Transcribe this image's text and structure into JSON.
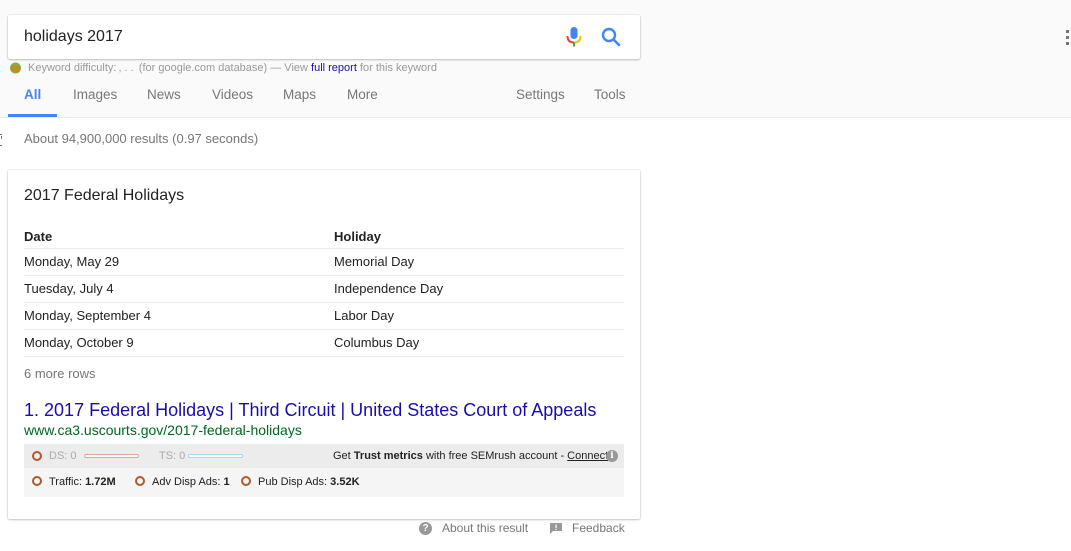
{
  "search": {
    "query": "holidays 2017",
    "mic_icon": "microphone-icon",
    "search_icon": "magnifier-icon"
  },
  "keyword_bar": {
    "logo_icon": "semrush-logo-icon",
    "prefix": "Keyword difficulty: ",
    "difficulty_value": ", . .",
    "middle": " (for google.com database) — View ",
    "link": "full report",
    "suffix": " for this keyword"
  },
  "tabs": {
    "items": [
      {
        "label": "All",
        "active": true
      },
      {
        "label": "Images"
      },
      {
        "label": "News"
      },
      {
        "label": "Videos"
      },
      {
        "label": "Maps"
      },
      {
        "label": "More"
      }
    ],
    "settings": "Settings",
    "tools": "Tools"
  },
  "result_stats": "About 94,900,000 results (0.97 seconds)",
  "featured": {
    "title": "2017 Federal Holidays",
    "columns": [
      "Date",
      "Holiday"
    ],
    "rows": [
      [
        "Monday, May 29",
        "Memorial Day"
      ],
      [
        "Tuesday, July 4",
        "Independence Day"
      ],
      [
        "Monday, September 4",
        "Labor Day"
      ],
      [
        "Monday, October 9",
        "Columbus Day"
      ]
    ],
    "more_rows": "6 more rows",
    "result": {
      "number": "1.",
      "title": "2017 Federal Holidays | Third Circuit | United States Court of Appeals",
      "url": "www.ca3.uscourts.gov/2017-federal-holidays"
    },
    "semrush": {
      "ds_label": "DS: 0",
      "ts_label": "TS: 0",
      "trust_prefix": "Get ",
      "trust_bold": "Trust metrics",
      "trust_suffix": " with free SEMrush account - ",
      "connect": "Connect",
      "traffic_label": "Traffic: ",
      "traffic_value": "1.72M",
      "adv_label": "Adv Disp Ads: ",
      "adv_value": "1",
      "pub_label": "Pub Disp Ads: ",
      "pub_value": "3.52K",
      "accent_color": "#b05a2a"
    }
  },
  "footer": {
    "about": "About this result",
    "feedback": "Feedback"
  }
}
